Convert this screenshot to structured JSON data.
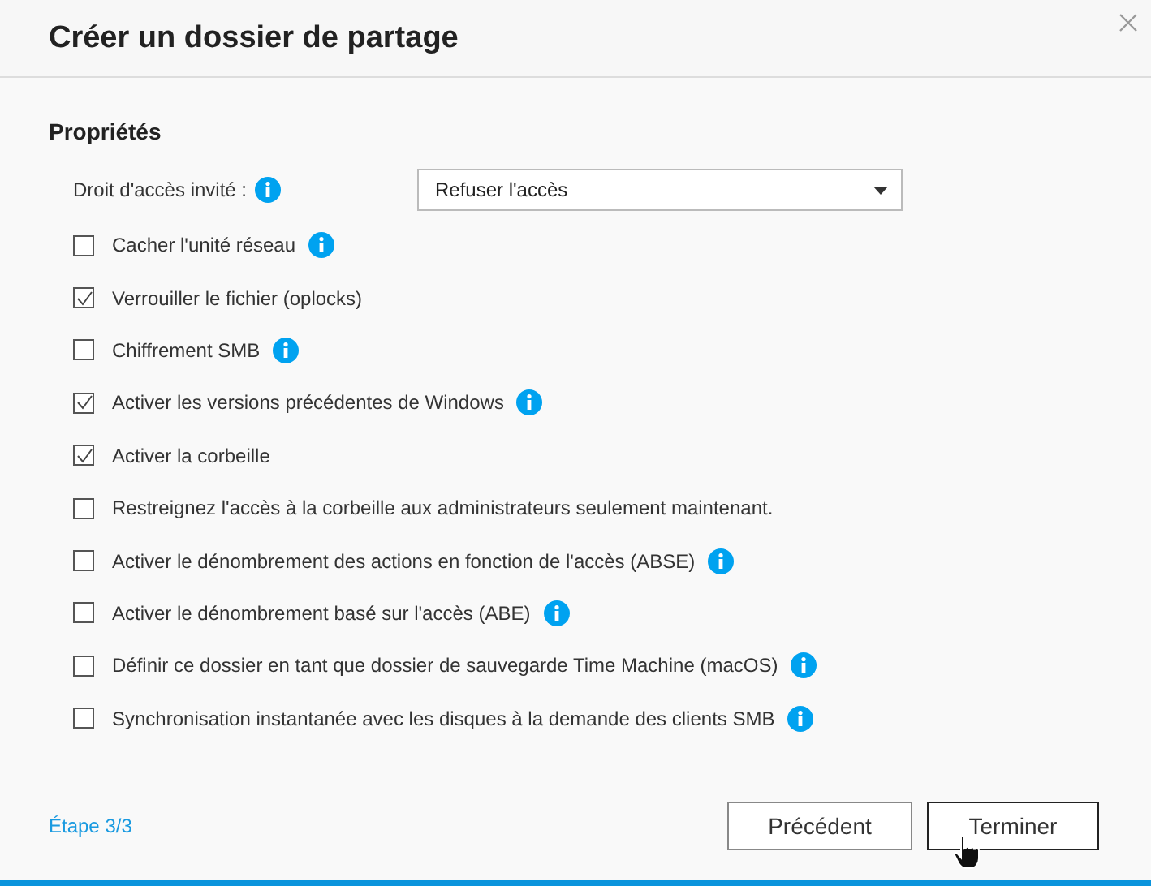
{
  "window": {
    "title": "Créer un dossier de partage"
  },
  "section": {
    "title": "Propriétés"
  },
  "guest_access": {
    "label": "Droit d'accès invité :",
    "value": "Refuser l'accès"
  },
  "options": [
    {
      "label": "Cacher l'unité réseau",
      "checked": false,
      "info": true
    },
    {
      "label": "Verrouiller le fichier (oplocks)",
      "checked": true,
      "info": false
    },
    {
      "label": "Chiffrement SMB",
      "checked": false,
      "info": true
    },
    {
      "label": "Activer les versions précédentes de Windows",
      "checked": true,
      "info": true
    },
    {
      "label": "Activer la corbeille",
      "checked": true,
      "info": false
    },
    {
      "label": "Restreignez l'accès à la corbeille aux administrateurs seulement maintenant.",
      "checked": false,
      "info": false
    },
    {
      "label": "Activer le dénombrement des actions en fonction de l'accès (ABSE)",
      "checked": false,
      "info": true
    },
    {
      "label": "Activer le dénombrement basé sur l'accès (ABE)",
      "checked": false,
      "info": true
    },
    {
      "label": "Définir ce dossier en tant que dossier de sauvegarde Time Machine (macOS)",
      "checked": false,
      "info": true
    },
    {
      "label": "Synchronisation instantanée avec les disques à la demande des clients SMB",
      "checked": false,
      "info": true
    }
  ],
  "footer": {
    "step": "Étape 3/3",
    "buttons": [
      {
        "label": "Précédent",
        "focused": false
      },
      {
        "label": "Terminer",
        "focused": true
      }
    ]
  }
}
